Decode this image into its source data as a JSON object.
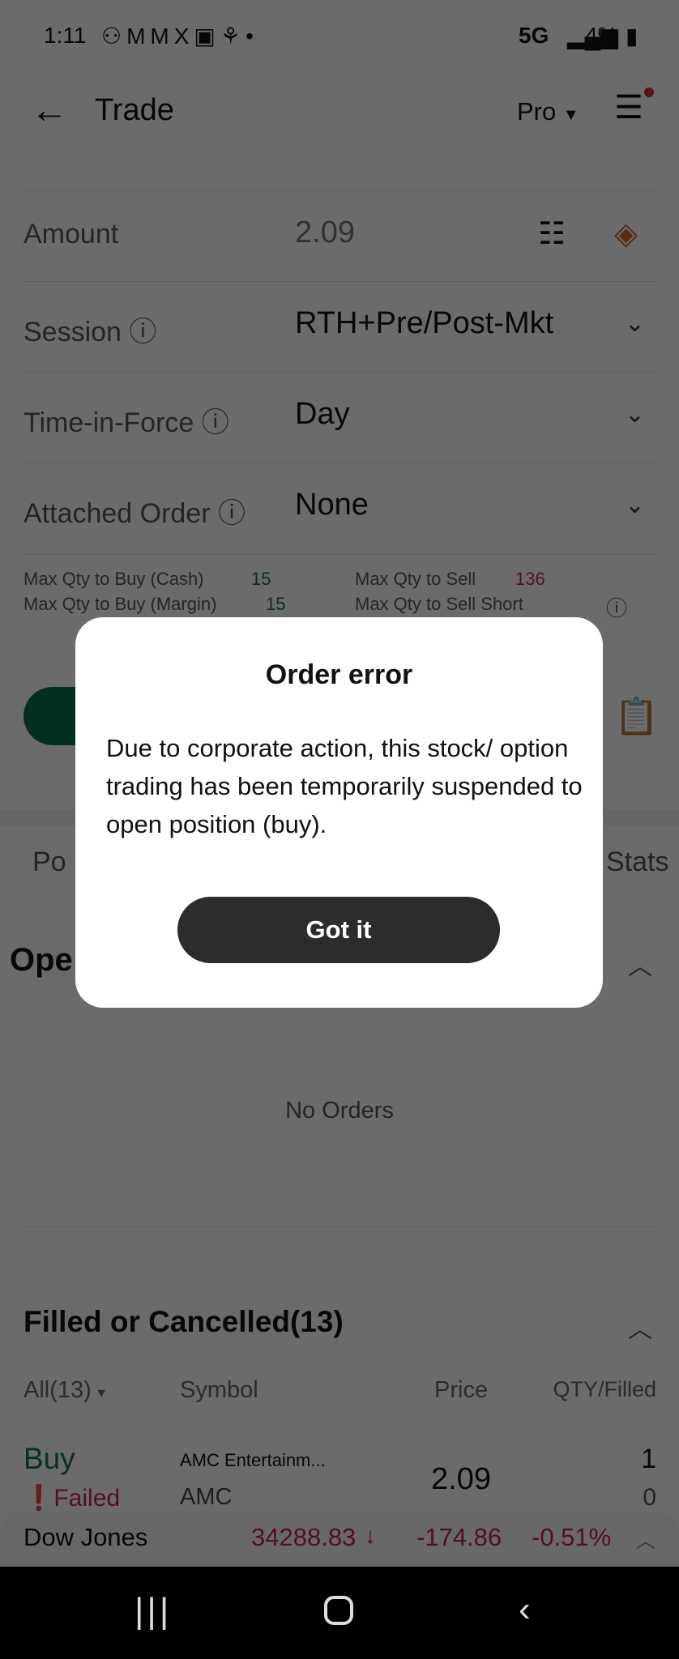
{
  "status_bar": {
    "time": "1:11",
    "network": "5G",
    "battery": "4%"
  },
  "header": {
    "title": "Trade",
    "mode": "Pro"
  },
  "form": {
    "amount": {
      "label": "Amount",
      "value": "2.09"
    },
    "session": {
      "label": "Session",
      "value": "RTH+Pre/Post-Mkt"
    },
    "tif": {
      "label": "Time-in-Force",
      "value": "Day"
    },
    "attached": {
      "label": "Attached Order",
      "value": "None"
    }
  },
  "qty": {
    "buy_cash_label": "Max Qty to Buy (Cash)",
    "buy_cash": "15",
    "sell_label": "Max Qty to Sell",
    "sell": "136",
    "buy_margin_label": "Max Qty to Buy (Margin)",
    "buy_margin": "15",
    "sell_short_label": "Max Qty to Sell Short"
  },
  "tabs": {
    "left": "Po",
    "right": "Stats"
  },
  "open_orders": {
    "title": "Ope",
    "empty": "No Orders"
  },
  "filled": {
    "title": "Filled or Cancelled(13)",
    "columns": {
      "filter": "All(13)",
      "symbol": "Symbol",
      "price": "Price",
      "qty": "QTY/Filled"
    },
    "rows": [
      {
        "side": "Buy",
        "status": "Failed",
        "name": "AMC Entertainm...",
        "symbol": "AMC",
        "price": "2.09",
        "qty": "1",
        "filled": "0"
      }
    ]
  },
  "ticker": {
    "name": "Dow Jones",
    "value": "34288.83",
    "change": "-174.86",
    "pct": "-0.51%"
  },
  "dialog": {
    "title": "Order error",
    "body": "Due to corporate action, this stock/ option trading has been temporarily suspended to open position (buy).",
    "button": "Got it"
  },
  "colors": {
    "green": "#0a7a45",
    "red": "#c0283d",
    "accent": "#d2691e"
  }
}
